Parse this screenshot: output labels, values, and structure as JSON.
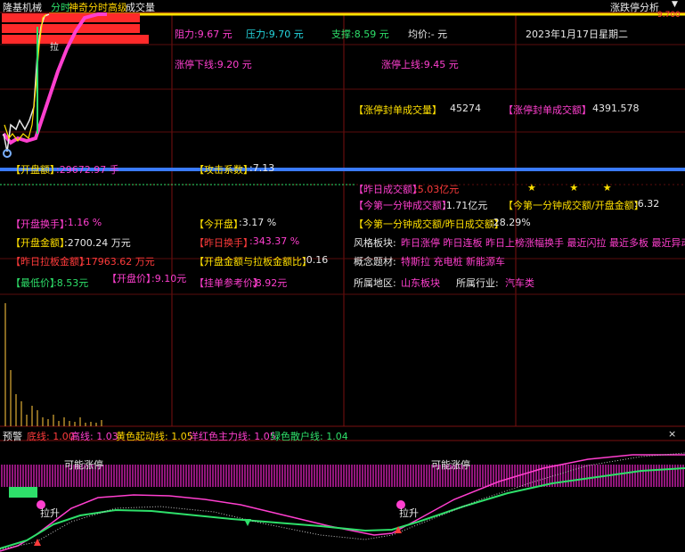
{
  "header": {
    "stock_name": "隆基机械",
    "mode": "分时",
    "indicator": "神奇分时高级",
    "volume": "成交量",
    "right_title": "涨跌停分析",
    "dropdown": "▼"
  },
  "price_pane": {
    "top_price": "9.700",
    "resistance_labels": {
      "zuli": "阻力:9.67 元",
      "yali": "压力:9.70 元",
      "zhicheng": "支撑:8.59 元",
      "junjia": "均价:- 元",
      "date": "2023年1月17日星期二"
    },
    "limit_down_line": "涨停下线:9.20 元",
    "limit_up_line": "涨停上线:9.45 元",
    "la_tag": "拉",
    "bg_bars": [
      "#ff2a2a",
      "#ff2a2a",
      "#ff2a2a"
    ]
  },
  "stats": {
    "seal_volume_label": "【涨停封单成交量】",
    "seal_volume_value": "45274",
    "seal_amount_label": "【涨停封单成交额】",
    "seal_amount_value": "4391.578",
    "open_seal_label": "【开盘额】",
    "open_seal_value": ":29672.97 手",
    "attack_label": "【攻击系数】",
    "attack_value": ":7.13",
    "prev_turnover_label": "【昨日成交额】",
    "prev_turnover_value": ":5.03亿元",
    "stars": [
      "★",
      "★",
      "★"
    ],
    "first_min_label": "【今第一分钟成交额】",
    "first_min_value": ":1.71亿元",
    "first_min_ratio_label": "【今第一分钟成交额/开盘金额】",
    "first_min_ratio_value": ":6.32",
    "open_turnover_label": "【开盘换手】",
    "open_turnover_value": ":1.16 %",
    "today_open_label": "【今开盘】",
    "today_open_value": ":3.17 %",
    "first_min_prev_label": "【今第一分钟成交额/昨日成交额】",
    "first_min_prev_value": ":28.29%",
    "open_amount_label": "【开盘金额】",
    "open_amount_value": ":2700.24 万元",
    "prev_day_label": "【昨日换手】",
    "prev_day_value": ":343.37 %",
    "style_label": "风格板块:",
    "style_value": "昨日涨停 昨日连板 昨日上榜涨幅换手 最近闪拉 最近多板 最近异动 近期",
    "prev_limit_amount_label": "【昨日拉板金额】",
    "prev_limit_amount_value": ":17963.62 万元",
    "open_limit_ratio_label": "【开盘金额与拉板金额比】",
    "open_limit_ratio_value": ":0.16",
    "concept_label": "概念题材:",
    "concept_value": "特斯拉 充电桩 新能源车",
    "open_price_label": "【开盘价】",
    "open_price_value": ":9.10元",
    "close_label": "【最低价】",
    "close_value": ":8.53元",
    "ref_price_label": "【挂单参考价】",
    "ref_price_value": ":8.92元",
    "region_label": "所属地区:",
    "region_value": "山东板块",
    "industry_label": "所属行业:",
    "industry_value": "汽车类"
  },
  "alert_bar": {
    "prefix": "预警",
    "dixian": "底线: 1.00",
    "gaoxian": "高线: 1.03",
    "huangse": "黄色起动线: 1.05",
    "yanghong": "洋红色主力线: 1.05",
    "lvse": "绿色散户线: 1.04",
    "close_icon": "×"
  },
  "lower_pane": {
    "possible_limit_1": "可能涨停",
    "possible_limit_2": "可能涨停",
    "la_sheng_1": "拉升",
    "la_sheng_2": "拉升"
  },
  "colors": {
    "price_line": "#ff3fcf",
    "avg_line": "#ffe000",
    "blue_line": "#3a7bff",
    "grid": "#7a1010",
    "green_line": "#2ee06a"
  }
}
